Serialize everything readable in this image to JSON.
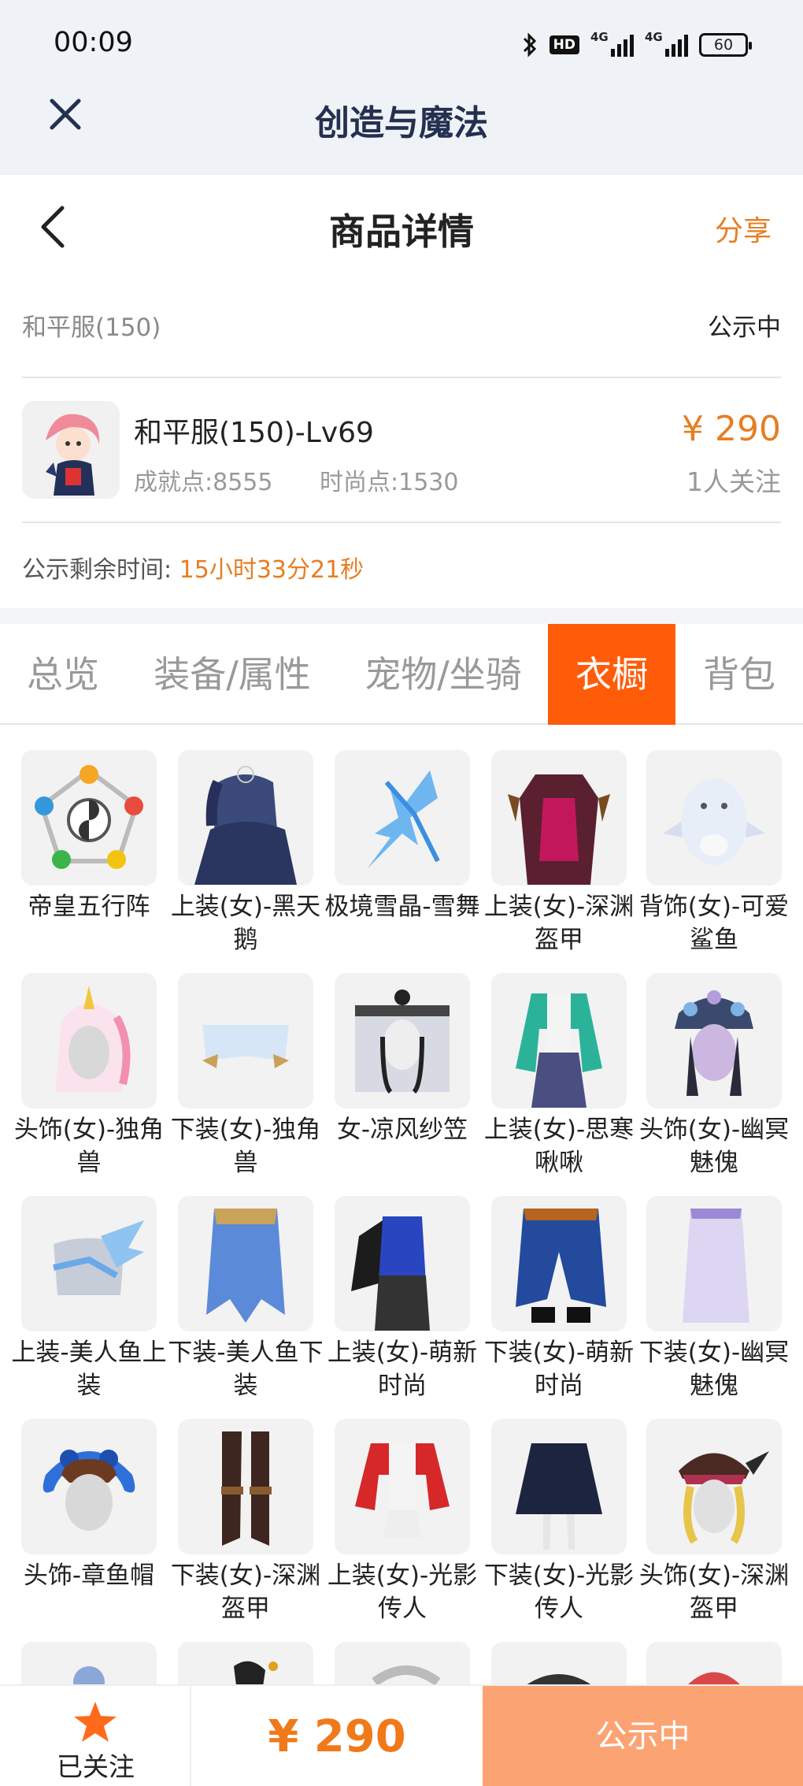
{
  "status_bar": {
    "time": "00:09",
    "hd_label": "HD",
    "signal_label": "4G",
    "battery": "60"
  },
  "app_bar": {
    "title": "创造与魔法"
  },
  "page_header": {
    "title": "商品详情",
    "share_label": "分享"
  },
  "listing": {
    "server": "和平服(150)",
    "status": "公示中",
    "product_name": "和平服(150)-Lv69",
    "achievement": "成就点:8555",
    "fashion": "时尚点:1530",
    "price": "¥ 290",
    "followers": "1人关注",
    "remaining_label": "公示剩余时间:",
    "remaining_value": "15小时33分21秒"
  },
  "tabs": [
    {
      "label": "总览",
      "active": false
    },
    {
      "label": "装备/属性",
      "active": false
    },
    {
      "label": "宠物/坐骑",
      "active": false
    },
    {
      "label": "衣橱",
      "active": true
    },
    {
      "label": "背包",
      "active": false
    }
  ],
  "wardrobe": [
    {
      "name": "帝皇五行阵",
      "icon": "five-elements-array-icon"
    },
    {
      "name": "上装(女)-黑天鹅",
      "icon": "black-swan-top-icon"
    },
    {
      "name": "极境雪晶-雪舞",
      "icon": "ice-crystal-scythe-icon"
    },
    {
      "name": "上装(女)-深渊盔甲",
      "icon": "abyss-armor-top-icon"
    },
    {
      "name": "背饰(女)-可爱鲨鱼",
      "icon": "cute-shark-back-icon"
    },
    {
      "name": "头饰(女)-独角兽",
      "icon": "unicorn-headwear-icon"
    },
    {
      "name": "下装(女)-独角兽",
      "icon": "unicorn-bottom-icon"
    },
    {
      "name": "女-凉风纱笠",
      "icon": "veil-hat-icon"
    },
    {
      "name": "上装(女)-思寒啾啾",
      "icon": "jacket-top-icon"
    },
    {
      "name": "头饰(女)-幽冥魅傀",
      "icon": "netherworld-headwear-icon"
    },
    {
      "name": "上装-美人鱼上装",
      "icon": "mermaid-top-icon"
    },
    {
      "name": "下装-美人鱼下装",
      "icon": "mermaid-bottom-icon"
    },
    {
      "name": "上装(女)-萌新时尚",
      "icon": "newbie-fashion-top-icon"
    },
    {
      "name": "下装(女)-萌新时尚",
      "icon": "newbie-fashion-bottom-icon"
    },
    {
      "name": "下装(女)-幽冥魅傀",
      "icon": "netherworld-bottom-icon"
    },
    {
      "name": "头饰-章鱼帽",
      "icon": "octopus-hat-icon"
    },
    {
      "name": "下装(女)-深渊盔甲",
      "icon": "abyss-armor-boots-icon"
    },
    {
      "name": "上装(女)-光影传人",
      "icon": "light-shadow-top-icon"
    },
    {
      "name": "下装(女)-光影传人",
      "icon": "light-shadow-skirt-icon"
    },
    {
      "name": "头饰(女)-深渊盔甲",
      "icon": "abyss-armor-headwear-icon"
    },
    {
      "name": "",
      "icon": "partial-item-icon"
    },
    {
      "name": "",
      "icon": "partial-item-icon"
    },
    {
      "name": "",
      "icon": "partial-item-icon"
    },
    {
      "name": "",
      "icon": "partial-item-icon"
    },
    {
      "name": "",
      "icon": "partial-item-icon"
    }
  ],
  "bottom_bar": {
    "follow_label": "已关注",
    "price": "¥ 290",
    "status_label": "公示中"
  },
  "colors": {
    "accent": "#e67e22",
    "tab_active": "#ff5c0a",
    "status_button": "#fca373"
  }
}
